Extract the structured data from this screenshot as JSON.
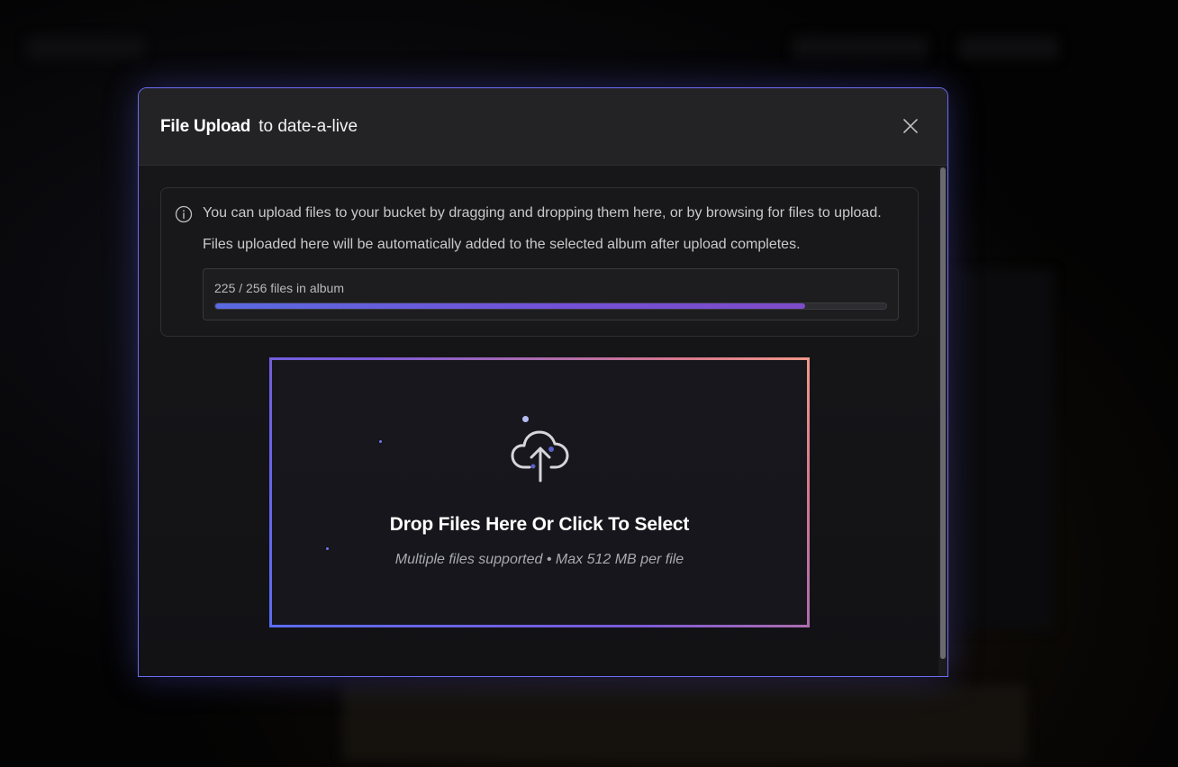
{
  "modal": {
    "title": "File Upload",
    "subtitle": "to date-a-live",
    "close_icon": "close-icon"
  },
  "info": {
    "icon": "info-icon",
    "line1": "You can upload files to your bucket by dragging and dropping them here, or by browsing for files to upload.",
    "line2": "Files uploaded here will be automatically added to the selected album after upload completes."
  },
  "album_progress": {
    "label": "225 / 256 files in album",
    "current": 225,
    "total": 256,
    "fraction": 0.879
  },
  "dropzone": {
    "icon": "cloud-upload-icon",
    "title": "Drop Files Here Or Click To Select",
    "subtitle": "Multiple files supported • Max 512 MB per file"
  },
  "colors": {
    "accent": "#6c6cf0",
    "progress_start": "#5a6ae0",
    "progress_end": "#7d4cc8",
    "dropzone_border_start": "#5b6cf0",
    "dropzone_border_end": "#f09a8a"
  }
}
